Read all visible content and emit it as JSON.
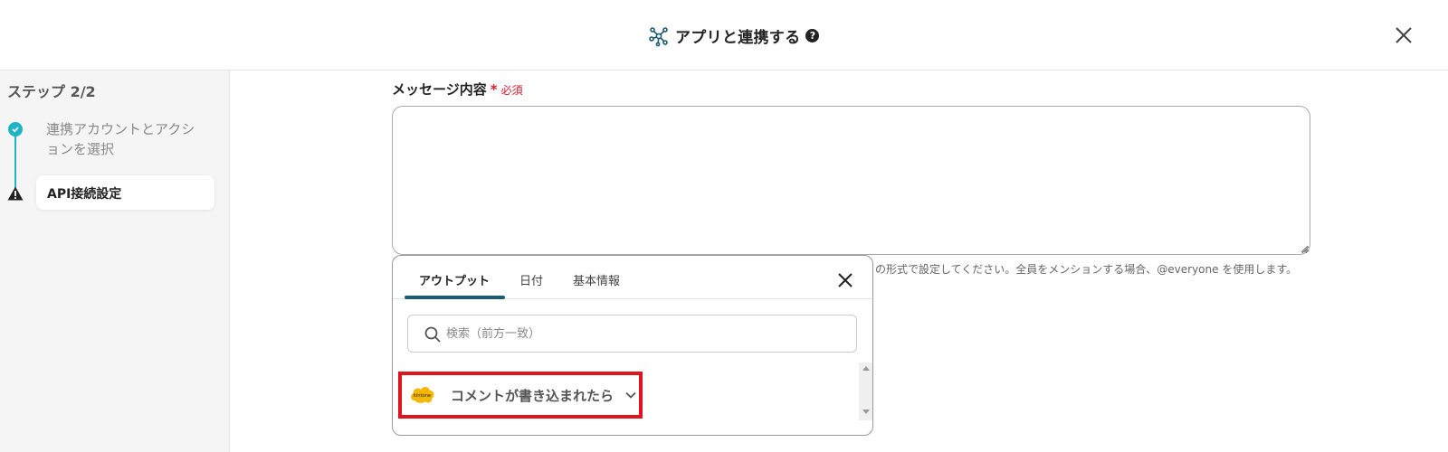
{
  "header": {
    "title": "アプリと連携する",
    "help_icon_char": "?"
  },
  "sidebar": {
    "step_count": "ステップ 2/2",
    "steps": [
      {
        "label": "連携アカウントとアクションを選択",
        "status": "complete"
      },
      {
        "label": "API接続設定",
        "status": "warning"
      }
    ]
  },
  "field": {
    "label": "メッセージ内容",
    "required_star": "*",
    "required_text": "必須",
    "value": "",
    "help_note": "の形式で設定してください。全員をメンションする場合、@everyone を使用します。"
  },
  "popup": {
    "tabs": [
      {
        "label": "アウトプット",
        "active": true
      },
      {
        "label": "日付",
        "active": false
      },
      {
        "label": "基本情報",
        "active": false
      }
    ],
    "search": {
      "placeholder": "検索（前方一致）",
      "value": ""
    },
    "items": [
      {
        "app": "kintone",
        "app_logo_text": "kintone",
        "label": "コメントが書き込まれたら"
      }
    ]
  },
  "colors": {
    "accent_teal": "#1fb4c8",
    "tab_underline": "#1a5c73",
    "required_red": "#e0192b",
    "highlight_red": "#e0141c",
    "kintone_yellow": "#f5b700"
  }
}
